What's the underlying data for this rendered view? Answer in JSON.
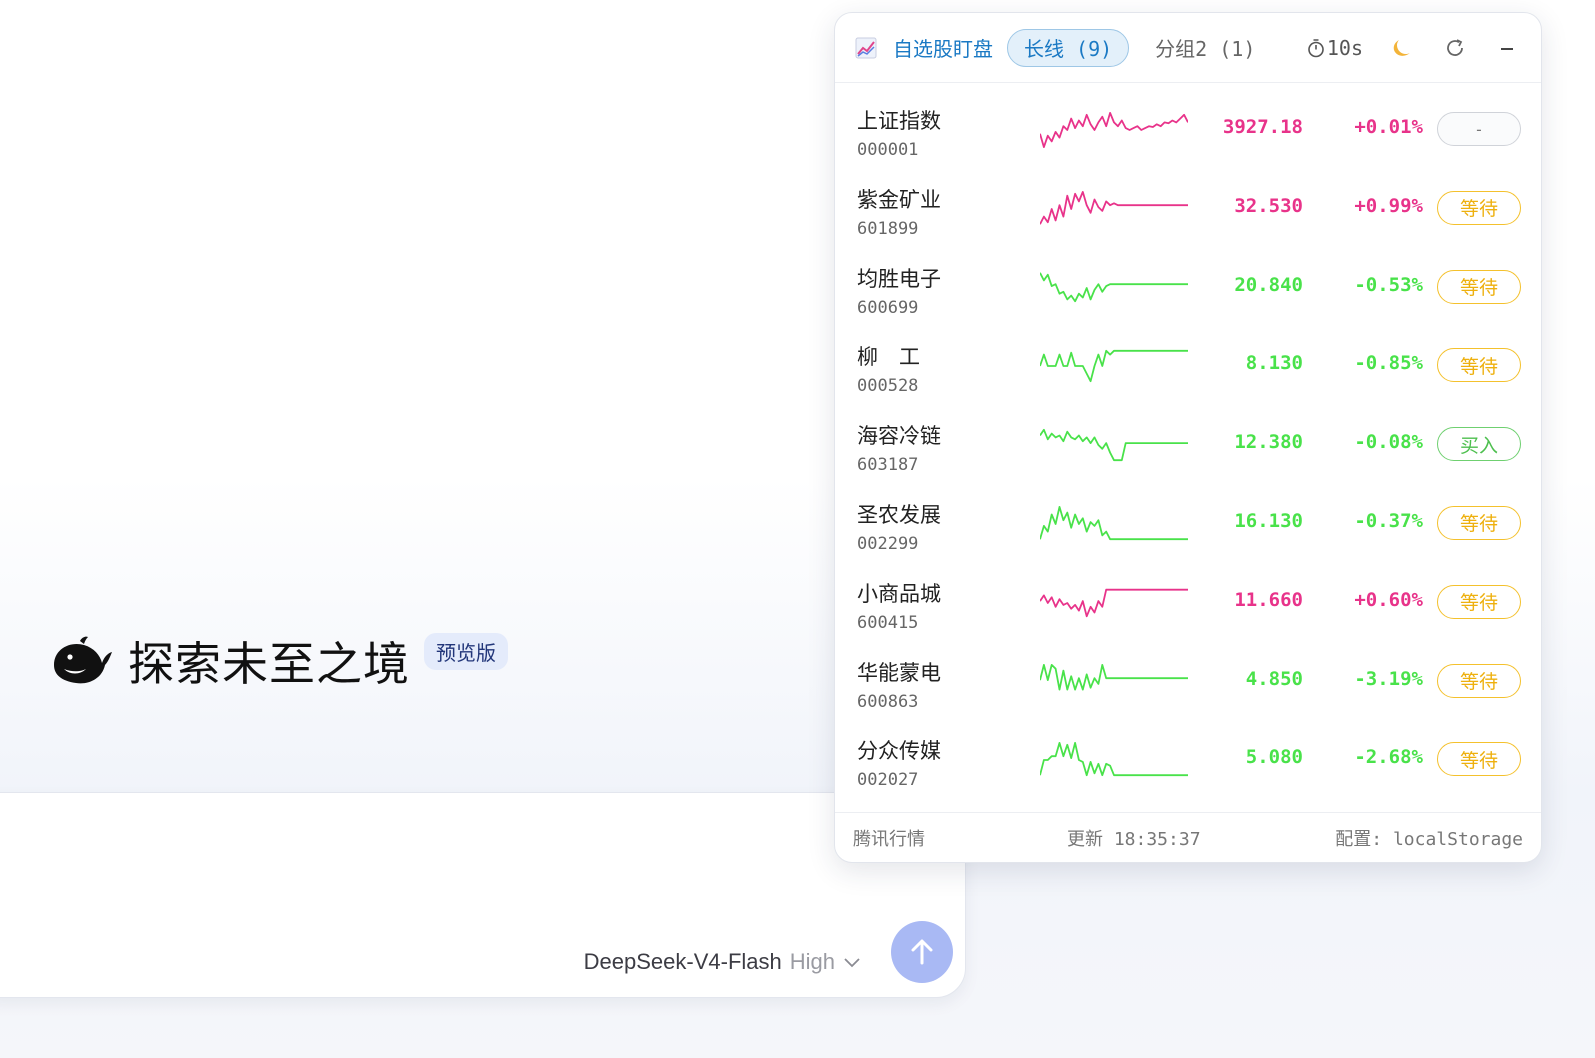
{
  "hero": {
    "title": "探索未至之境",
    "badge": "预览版"
  },
  "composer": {
    "model_name": "DeepSeek-V4-Flash",
    "model_level": "High"
  },
  "widget": {
    "title": "自选股盯盘",
    "tabs": [
      {
        "label": "长线 (9)",
        "active": true
      },
      {
        "label": "分组2 (1)",
        "active": false
      }
    ],
    "refresh_interval": "10s",
    "stocks": [
      {
        "name": "上证指数",
        "code": "000001",
        "price": "3927.18",
        "change": "+0.01%",
        "signal": "-",
        "signal_type": "none",
        "trend": "up",
        "spark": [
          0.4,
          0.05,
          0.35,
          0.2,
          0.45,
          0.3,
          0.6,
          0.5,
          0.8,
          0.55,
          0.75,
          0.6,
          0.9,
          0.65,
          0.5,
          0.7,
          0.85,
          0.6,
          0.95,
          0.7,
          0.6,
          0.75,
          0.55,
          0.5,
          0.55,
          0.6,
          0.5,
          0.55,
          0.6,
          0.58,
          0.65,
          0.6,
          0.7,
          0.68,
          0.75,
          0.7,
          0.8,
          0.9,
          0.7
        ]
      },
      {
        "name": "紫金矿业",
        "code": "601899",
        "price": "32.530",
        "change": "+0.99%",
        "signal": "等待",
        "signal_type": "wait",
        "trend": "up",
        "spark": [
          0.1,
          0.3,
          0.15,
          0.5,
          0.2,
          0.6,
          0.3,
          0.85,
          0.5,
          0.9,
          0.7,
          0.95,
          0.6,
          0.4,
          0.75,
          0.55,
          0.45,
          0.7,
          0.6,
          0.65,
          0.6,
          0.6,
          0.6,
          0.6,
          0.6,
          0.6,
          0.6,
          0.6,
          0.6,
          0.6,
          0.6,
          0.6,
          0.6,
          0.6,
          0.6,
          0.6,
          0.6,
          0.6,
          0.6
        ]
      },
      {
        "name": "均胜电子",
        "code": "600699",
        "price": "20.840",
        "change": "-0.53%",
        "signal": "等待",
        "signal_type": "wait",
        "trend": "down",
        "spark": [
          0.9,
          0.7,
          0.85,
          0.55,
          0.6,
          0.35,
          0.4,
          0.2,
          0.3,
          0.15,
          0.35,
          0.25,
          0.5,
          0.2,
          0.45,
          0.6,
          0.4,
          0.55,
          0.6,
          0.6,
          0.6,
          0.6,
          0.6,
          0.6,
          0.6,
          0.6,
          0.6,
          0.6,
          0.6,
          0.6,
          0.6,
          0.6,
          0.6,
          0.6,
          0.6,
          0.6,
          0.6,
          0.6,
          0.6
        ]
      },
      {
        "name": "柳　工",
        "code": "000528",
        "price": "8.130",
        "change": "-0.85%",
        "signal": "等待",
        "signal_type": "wait",
        "trend": "down",
        "spark": [
          0.5,
          0.8,
          0.5,
          0.5,
          0.5,
          0.8,
          0.5,
          0.5,
          0.85,
          0.5,
          0.5,
          0.5,
          0.3,
          0.1,
          0.5,
          0.8,
          0.5,
          0.9,
          0.8,
          0.9,
          0.9,
          0.9,
          0.9,
          0.9,
          0.9,
          0.9,
          0.9,
          0.9,
          0.9,
          0.9,
          0.9,
          0.9,
          0.9,
          0.9,
          0.9,
          0.9,
          0.9,
          0.9,
          0.9
        ]
      },
      {
        "name": "海容冷链",
        "code": "603187",
        "price": "12.380",
        "change": "-0.08%",
        "signal": "买入",
        "signal_type": "buy",
        "trend": "down",
        "spark": [
          0.75,
          0.9,
          0.65,
          0.8,
          0.7,
          0.75,
          0.6,
          0.85,
          0.7,
          0.65,
          0.75,
          0.6,
          0.7,
          0.55,
          0.7,
          0.5,
          0.4,
          0.55,
          0.3,
          0.1,
          0.1,
          0.1,
          0.55,
          0.55,
          0.55,
          0.55,
          0.55,
          0.55,
          0.55,
          0.55,
          0.55,
          0.55,
          0.55,
          0.55,
          0.55,
          0.55,
          0.55,
          0.55,
          0.55
        ]
      },
      {
        "name": "圣农发展",
        "code": "002299",
        "price": "16.130",
        "change": "-0.37%",
        "signal": "等待",
        "signal_type": "wait",
        "trend": "down",
        "spark": [
          0.1,
          0.45,
          0.3,
          0.75,
          0.5,
          0.95,
          0.6,
          0.8,
          0.4,
          0.75,
          0.5,
          0.65,
          0.3,
          0.55,
          0.45,
          0.6,
          0.2,
          0.3,
          0.1,
          0.1,
          0.1,
          0.1,
          0.1,
          0.1,
          0.1,
          0.1,
          0.1,
          0.1,
          0.1,
          0.1,
          0.1,
          0.1,
          0.1,
          0.1,
          0.1,
          0.1,
          0.1,
          0.1,
          0.1
        ]
      },
      {
        "name": "小商品城",
        "code": "600415",
        "price": "11.660",
        "change": "+0.60%",
        "signal": "等待",
        "signal_type": "wait",
        "trend": "up",
        "spark": [
          0.55,
          0.7,
          0.5,
          0.65,
          0.4,
          0.6,
          0.45,
          0.5,
          0.35,
          0.45,
          0.3,
          0.55,
          0.15,
          0.4,
          0.25,
          0.55,
          0.4,
          0.85,
          0.85,
          0.85,
          0.85,
          0.85,
          0.85,
          0.85,
          0.85,
          0.85,
          0.85,
          0.85,
          0.85,
          0.85,
          0.85,
          0.85,
          0.85,
          0.85,
          0.85,
          0.85,
          0.85,
          0.85,
          0.85
        ]
      },
      {
        "name": "华能蒙电",
        "code": "600863",
        "price": "4.850",
        "change": "-3.19%",
        "signal": "等待",
        "signal_type": "wait",
        "trend": "down",
        "spark": [
          0.55,
          0.95,
          0.55,
          0.95,
          0.85,
          0.3,
          0.8,
          0.3,
          0.65,
          0.3,
          0.6,
          0.3,
          0.7,
          0.35,
          0.6,
          0.45,
          0.95,
          0.6,
          0.6,
          0.6,
          0.6,
          0.6,
          0.6,
          0.6,
          0.6,
          0.6,
          0.6,
          0.6,
          0.6,
          0.6,
          0.6,
          0.6,
          0.6,
          0.6,
          0.6,
          0.6,
          0.6,
          0.6,
          0.6
        ]
      },
      {
        "name": "分众传媒",
        "code": "002027",
        "price": "5.080",
        "change": "-2.68%",
        "signal": "等待",
        "signal_type": "wait",
        "trend": "down",
        "spark": [
          0.1,
          0.5,
          0.5,
          0.6,
          0.6,
          0.95,
          0.6,
          0.9,
          0.55,
          0.95,
          0.5,
          0.45,
          0.1,
          0.45,
          0.15,
          0.4,
          0.1,
          0.4,
          0.35,
          0.1,
          0.1,
          0.1,
          0.1,
          0.1,
          0.1,
          0.1,
          0.1,
          0.1,
          0.1,
          0.1,
          0.1,
          0.1,
          0.1,
          0.1,
          0.1,
          0.1,
          0.1,
          0.1,
          0.1
        ]
      }
    ],
    "footer": {
      "source": "腾讯行情",
      "update": "更新 18:35:37",
      "config": "配置: localStorage"
    }
  },
  "colors": {
    "up": "#e8338a",
    "down": "#49e24a",
    "accent": "#1a79c4",
    "wait": "#f4c12d"
  },
  "icons": {
    "logo": "chart-icon",
    "timer": "stopwatch-icon",
    "theme": "moon-icon",
    "refresh": "refresh-icon",
    "minimize": "minimize-icon",
    "model_dropdown": "chevron-down-icon",
    "send": "arrow-up-icon"
  }
}
